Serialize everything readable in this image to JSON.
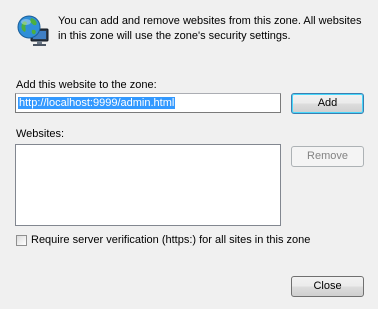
{
  "intro": {
    "text": "You can add and remove websites from this zone. All websites in this zone will use the zone's security settings."
  },
  "add_site": {
    "label": "Add this website to the zone:",
    "value": "http://localhost:9999/admin.html",
    "add_button": "Add"
  },
  "websites": {
    "label": "Websites:",
    "items": [],
    "remove_button": "Remove"
  },
  "verification": {
    "label": "Require server verification (https:) for all sites in this zone",
    "checked": false
  },
  "footer": {
    "close_button": "Close"
  },
  "icons": {
    "zone": "globe-computer-icon"
  }
}
